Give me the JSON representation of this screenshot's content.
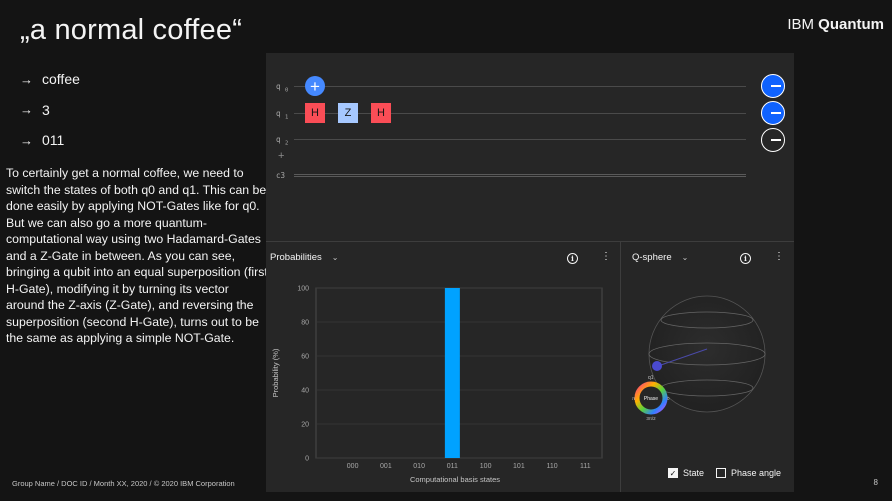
{
  "slide": {
    "title": "„a normal coffee“",
    "brand_prefix": "IBM",
    "brand_name": "Quantum",
    "bullets": [
      {
        "arrow": "→",
        "text": "coffee"
      },
      {
        "arrow": "→",
        "text": "3"
      },
      {
        "arrow": "→",
        "text": "011"
      }
    ],
    "body": "To certainly get a normal coffee, we need to switch the states of both q0 and q1. This can be done easily by applying NOT-Gates like for q0.  But we can also go a more quantum-computational way using two Hadamard-Gates and a Z-Gate in between. As you can see, bringing a qubit into an equal superposition (first H-Gate), modifying it by turning its vector around the Z-axis (Z-Gate), and reversing the superposition (second H-Gate), turns out to be the same as applying a simple NOT-Gate.",
    "footer": "Group Name / DOC ID / Month XX, 2020 / © 2020 IBM Corporation",
    "page_number": "8"
  },
  "circuit": {
    "wires": [
      {
        "label": "q",
        "index": "0"
      },
      {
        "label": "q",
        "index": "1"
      },
      {
        "label": "q",
        "index": "2"
      }
    ],
    "classical_label": "c3",
    "add_wire": "+",
    "gates": {
      "h": "H",
      "z": "Z",
      "not": "+"
    },
    "measurements": [
      {
        "qubit": "q0",
        "state": "on",
        "icon": "measure-icon"
      },
      {
        "qubit": "q1",
        "state": "on",
        "icon": "measure-icon"
      },
      {
        "qubit": "q2",
        "state": "off",
        "icon": "measure-icon"
      }
    ]
  },
  "probabilities": {
    "title": "Probabilities",
    "chevron": "⌄",
    "info": "i",
    "menu": "⋮"
  },
  "chart_data": {
    "type": "bar",
    "categories": [
      "000",
      "001",
      "010",
      "011",
      "100",
      "101",
      "110",
      "111"
    ],
    "values": [
      0,
      0,
      0,
      100,
      0,
      0,
      0,
      0
    ],
    "xlabel": "Computational basis states",
    "ylabel": "Probability (%)",
    "yticks": [
      "0",
      "20",
      "40",
      "60",
      "80",
      "100"
    ],
    "ylim": [
      0,
      100
    ],
    "bar_color": "#00a2ff",
    "grid": true
  },
  "qsphere_panel": {
    "title": "Q-sphere",
    "chevron": "⌄",
    "info": "i",
    "menu": "⋮",
    "state_label": "q1",
    "phase_label": "Phase",
    "phase_left": "π",
    "phase_right": "0",
    "phase_bottom": "3π/2",
    "state_checkbox": {
      "label": "State",
      "checked": true,
      "mark": "✓"
    },
    "phase_checkbox": {
      "label": "Phase angle",
      "checked": false,
      "mark": ""
    }
  }
}
